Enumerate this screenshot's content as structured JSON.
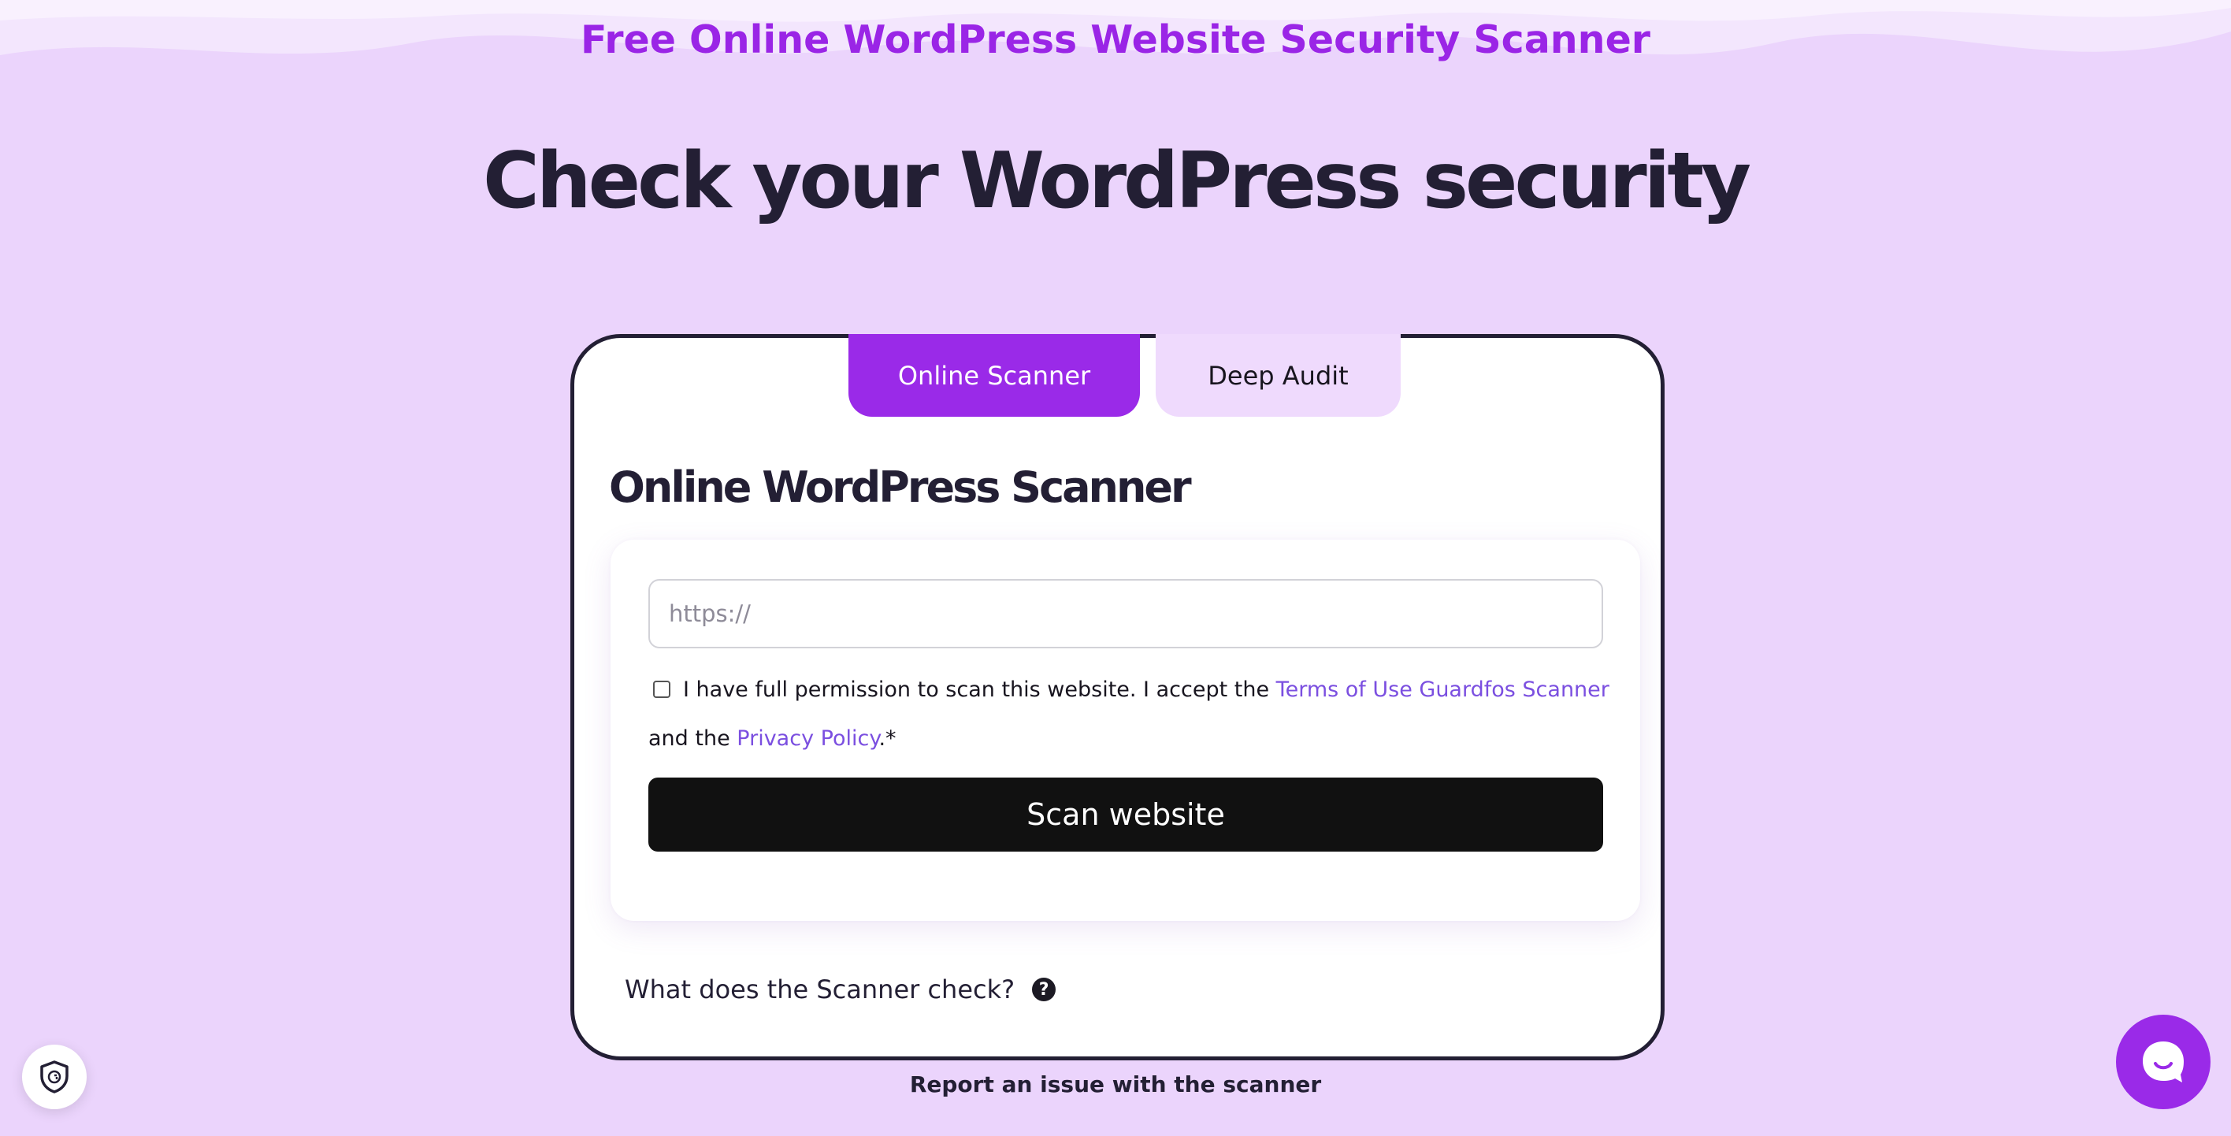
{
  "header": {
    "eyebrow": "Free Online WordPress Website Security Scanner",
    "title": "Check your WordPress security"
  },
  "tabs": [
    {
      "label": "Online Scanner",
      "active": true
    },
    {
      "label": "Deep Audit",
      "active": false
    }
  ],
  "scanner": {
    "title": "Online WordPress Scanner",
    "url_placeholder": "https://",
    "url_value": "",
    "consent_checked": false,
    "consent_prefix": "I have full permission to scan this website. I accept the",
    "terms_link": "Terms of Use Guardfos Scanner",
    "consent_middle": "and the",
    "privacy_link": "Privacy Policy",
    "consent_suffix": ".*",
    "scan_button": "Scan website",
    "faq_label": "What does the Scanner check?"
  },
  "footer": {
    "report_link": "Report an issue with the scanner"
  },
  "icons": {
    "badge": "shield-icon",
    "chat": "chat-bubble-icon",
    "help": "question-circle-icon"
  },
  "colors": {
    "background": "#ebd4fc",
    "accent": "#9a2ae8",
    "link": "#7b4fe0",
    "dark": "#231f34",
    "button": "#111111"
  }
}
